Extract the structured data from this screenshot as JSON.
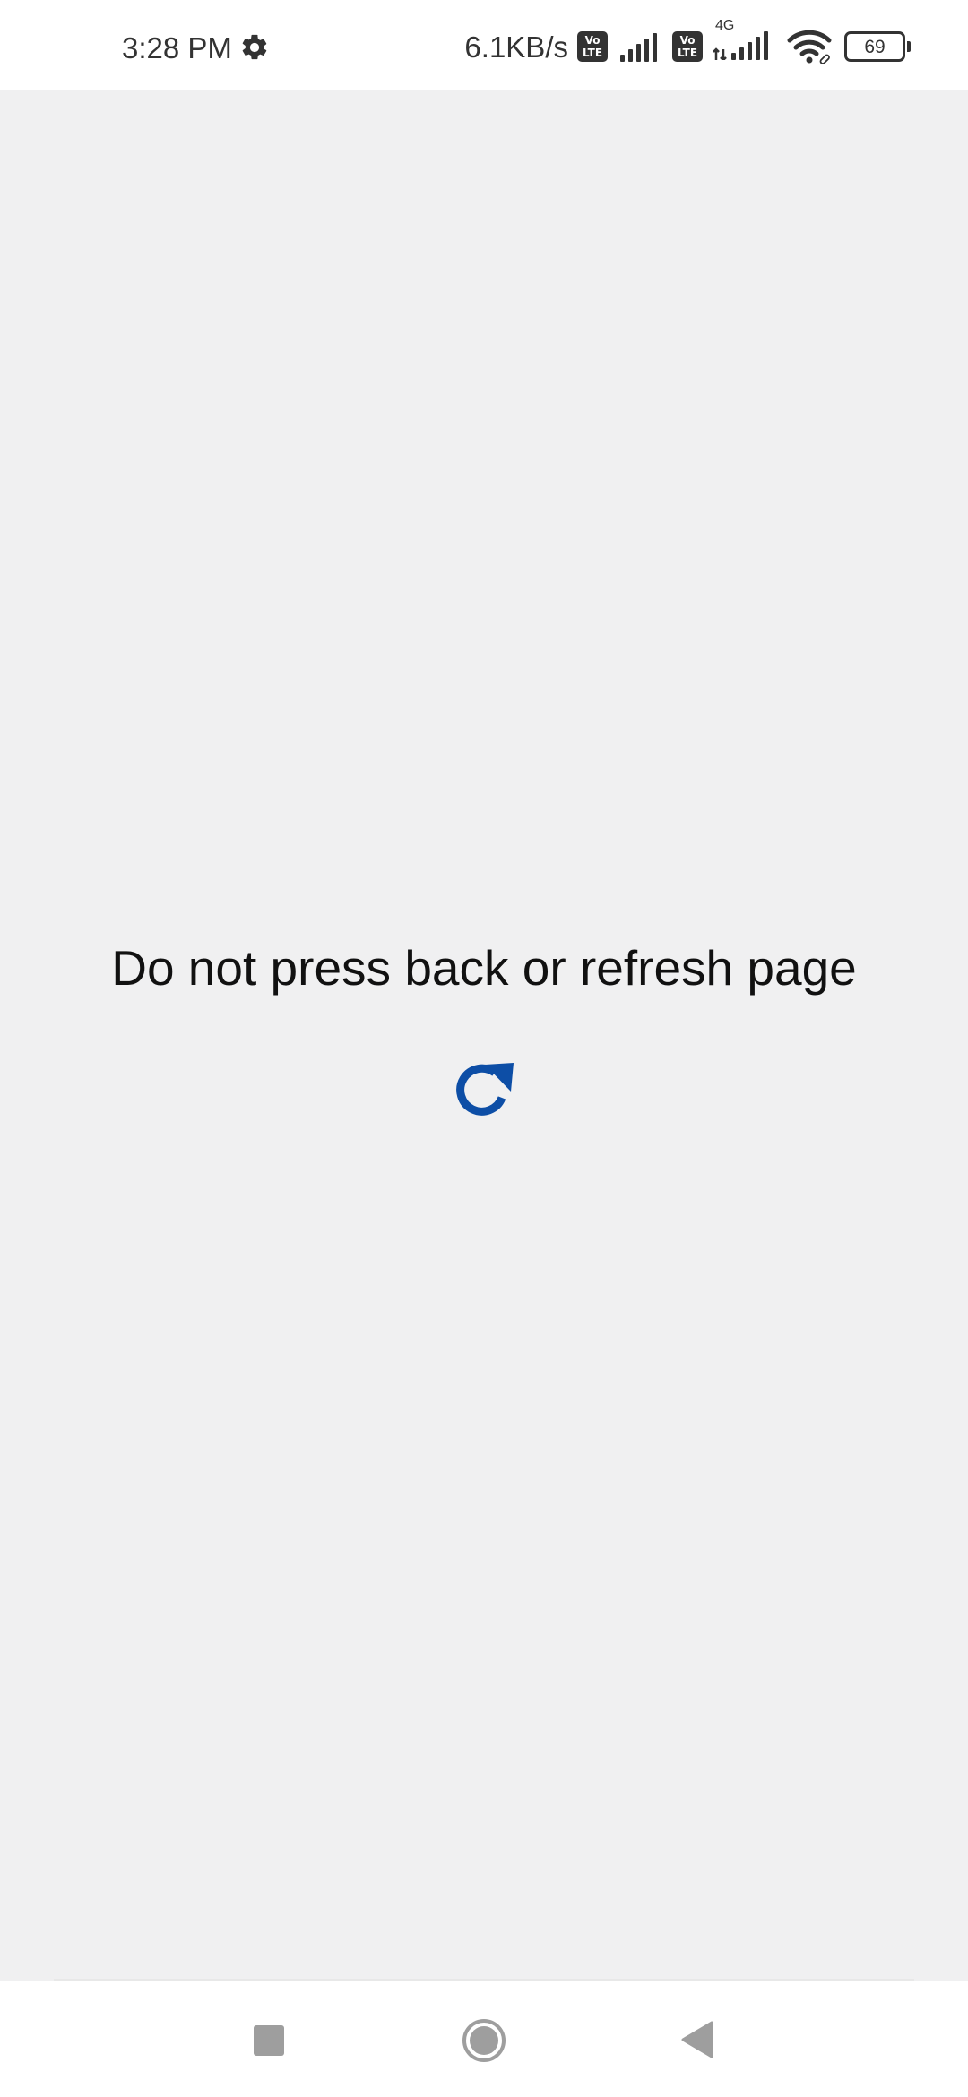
{
  "status_bar": {
    "time": "3:28 PM",
    "net_speed": "6.1KB/s",
    "sim1_badge": [
      "Vo",
      "LTE"
    ],
    "sim2_badge": [
      "Vo",
      "LTE"
    ],
    "network_type": "4G",
    "battery_level": "69",
    "icons": [
      "settings-gear-icon",
      "volte-icon",
      "signal-icon",
      "wifi-icon",
      "battery-icon"
    ]
  },
  "main": {
    "message": "Do not press back or refresh page",
    "loading_icon": "refresh-icon",
    "accent_color": "#0d4ea6"
  },
  "nav_bar": {
    "buttons": [
      "recent-apps",
      "home",
      "back"
    ]
  }
}
